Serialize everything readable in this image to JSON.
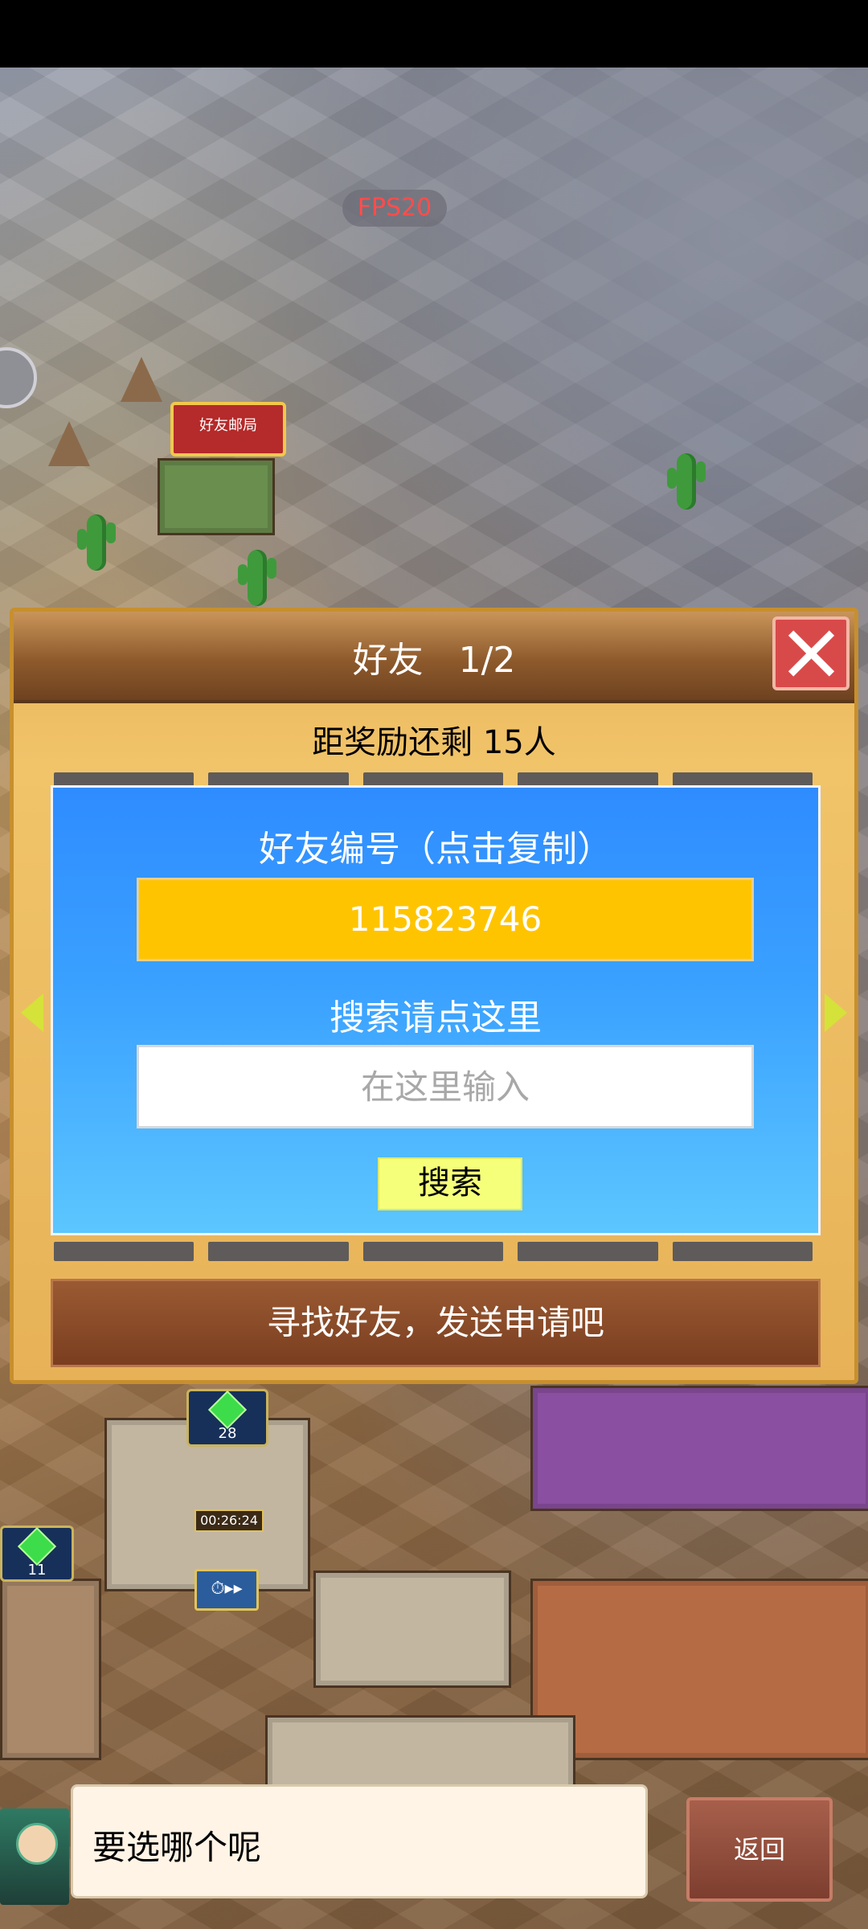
{
  "fps": "FPS20",
  "map": {
    "mail_sign": "好友邮局",
    "gem_badge_a": "28",
    "gem_badge_b": "11",
    "timer": "00:26:24"
  },
  "panel": {
    "title": "好友　1/2",
    "reward_text": "距奖励还剩 15人",
    "friend_id_label": "好友编号（点击复制）",
    "friend_id_value": "115823746",
    "search_hint": "搜索请点这里",
    "search_placeholder": "在这里输入",
    "search_button": "搜索",
    "find_friends_button": "寻找好友，发送申请吧"
  },
  "dialog": {
    "text": "要选哪个呢",
    "back_button": "返回"
  },
  "colors": {
    "panel_gold": "#f1c46a",
    "panel_header_brown": "#8e5a2c",
    "blue_box": "#3aa1ff",
    "id_yellow": "#ffc400",
    "search_button_yellow": "#f6ff7a",
    "close_red": "#d84a4a"
  }
}
